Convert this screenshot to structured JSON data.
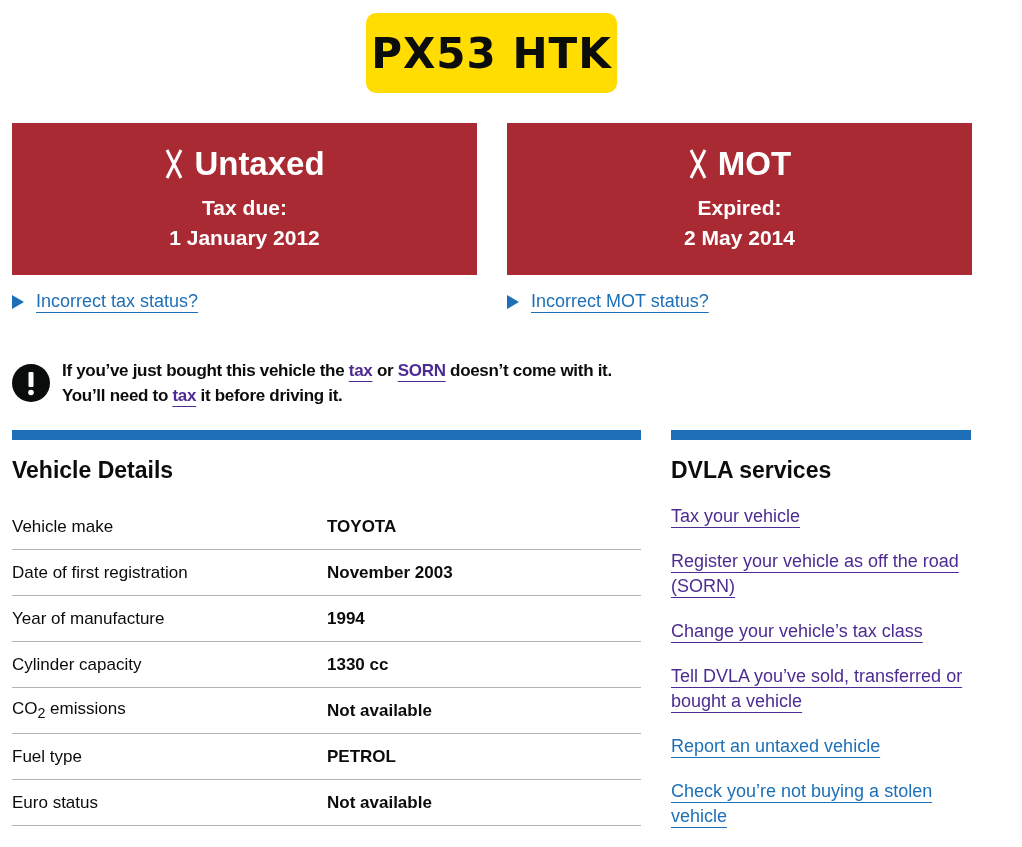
{
  "plate": "PX53 HTK",
  "status_cards": [
    {
      "kind": "fail",
      "title": "Untaxed",
      "label": "Tax due:",
      "date": "1 January 2012",
      "link": "Incorrect tax status?",
      "expanded": false
    },
    {
      "kind": "fail",
      "title": "MOT",
      "label": "Expired:",
      "date": "2 May 2014",
      "link": "Incorrect MOT status?",
      "expanded": false
    }
  ],
  "warning": [
    {
      "kind": "text",
      "text": "If you’ve just bought this vehicle the "
    },
    {
      "kind": "link",
      "text": "tax",
      "visited": true
    },
    {
      "kind": "text",
      "text": " or "
    },
    {
      "kind": "link",
      "text": "SORN",
      "visited": true
    },
    {
      "kind": "text",
      "text": " doesn’t come with it. You’ll need to "
    },
    {
      "kind": "link",
      "text": "tax",
      "visited": true
    },
    {
      "kind": "text",
      "text": " it before driving it."
    }
  ],
  "vehicle_details": {
    "heading": "Vehicle Details",
    "rows": [
      {
        "label": "Vehicle make",
        "value": "TOYOTA"
      },
      {
        "label": "Date of first registration",
        "value": "November 2003"
      },
      {
        "label": "Year of manufacture",
        "value": "1994"
      },
      {
        "label": "Cylinder capacity",
        "value": "1330 cc"
      },
      {
        "label": "CO$_{2}$ emissions",
        "value": "Not available"
      },
      {
        "label": "Fuel type",
        "value": "PETROL"
      },
      {
        "label": "Euro status",
        "value": "Not available"
      }
    ]
  },
  "dvla_services": {
    "heading": "DVLA services",
    "links": [
      {
        "text": "Tax your vehicle",
        "visited": true
      },
      {
        "text": "Register your vehicle as off the road (SORN)",
        "visited": true
      },
      {
        "text": "Change your vehicle’s tax class",
        "visited": true
      },
      {
        "text": "Tell DVLA you’ve sold, transferred or bought a vehicle",
        "visited": true
      },
      {
        "text": "Report an untaxed vehicle",
        "visited": false
      },
      {
        "text": "Check you’re not buying a stolen vehicle",
        "visited": false
      }
    ]
  }
}
